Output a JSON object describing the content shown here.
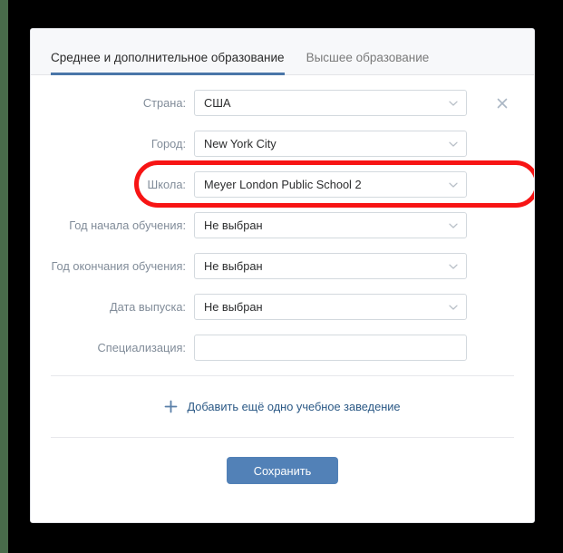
{
  "colors": {
    "accent_blue": "#4a76a8",
    "button_blue": "#5281b7",
    "link_blue": "#2a5885",
    "label_gray": "#818c99",
    "highlight_red": "#f71414",
    "header_bg": "#f7f8fa",
    "border": "#d3d9de"
  },
  "tabs": [
    {
      "label": "Среднее и дополнительное образование",
      "active": true
    },
    {
      "label": "Высшее образование",
      "active": false
    }
  ],
  "form": {
    "fields": [
      {
        "label": "Страна:",
        "value": "США",
        "type": "select",
        "has_clear": true,
        "clear_icon": "close-icon",
        "highlighted": false
      },
      {
        "label": "Город:",
        "value": "New York City",
        "type": "select",
        "has_clear": false,
        "highlighted": true
      },
      {
        "label": "Школа:",
        "value": "Meyer London Public School 2",
        "type": "select",
        "has_clear": false,
        "highlighted": false
      },
      {
        "label": "Год начала обучения:",
        "value": "Не выбран",
        "type": "select",
        "has_clear": false,
        "highlighted": false
      },
      {
        "label": "Год окончания обучения:",
        "value": "Не выбран",
        "type": "select",
        "has_clear": false,
        "highlighted": false
      },
      {
        "label": "Дата выпуска:",
        "value": "Не выбран",
        "type": "select",
        "has_clear": false,
        "highlighted": false
      },
      {
        "label": "Специализация:",
        "value": "",
        "placeholder": "",
        "type": "text",
        "has_clear": false,
        "highlighted": false
      }
    ]
  },
  "footer": {
    "add_label": "Добавить ещё одно учебное заведение",
    "add_icon": "plus-icon",
    "save_label": "Сохранить"
  }
}
